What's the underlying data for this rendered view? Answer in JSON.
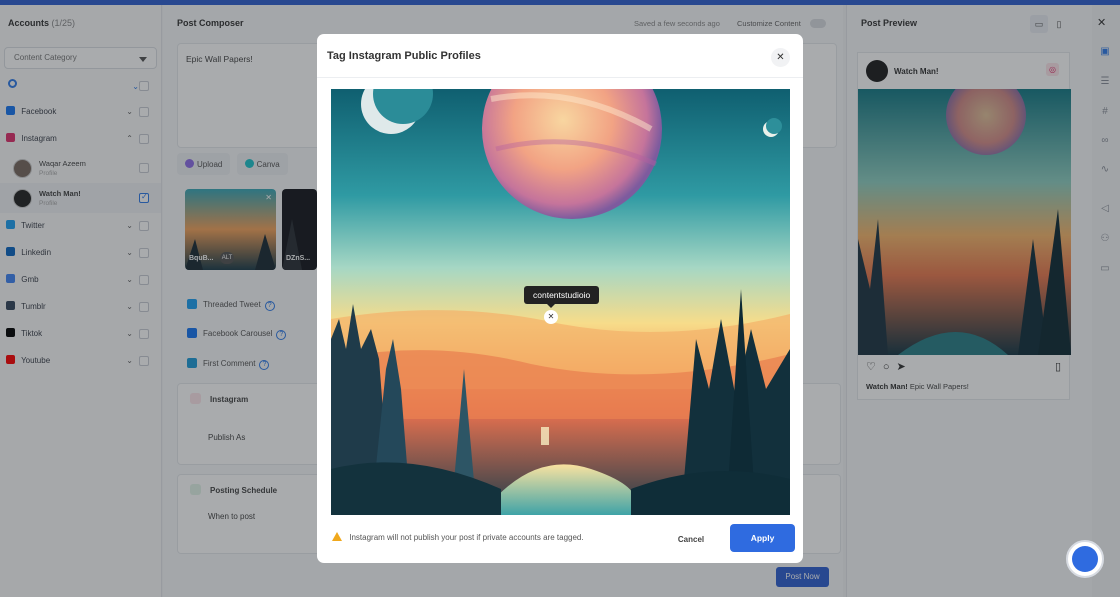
{
  "accounts": {
    "title": "Accounts",
    "count": "(1/25)",
    "category_placeholder": "Content Category",
    "networks": [
      {
        "name": "Facebook",
        "color": "#1877f2"
      },
      {
        "name": "Instagram",
        "color": "#e1306c"
      },
      {
        "name": "Twitter",
        "color": "#1da1f2"
      },
      {
        "name": "Linkedin",
        "color": "#0a66c2"
      },
      {
        "name": "Gmb",
        "color": "#4285f4"
      },
      {
        "name": "Tumblr",
        "color": "#35465c"
      },
      {
        "name": "Tiktok",
        "color": "#000000"
      },
      {
        "name": "Youtube",
        "color": "#ff0000"
      }
    ],
    "profiles": [
      {
        "name": "Waqar Azeem",
        "type": "Profile",
        "checked": false
      },
      {
        "name": "Watch Man!",
        "type": "Profile",
        "checked": true
      }
    ]
  },
  "composer": {
    "title": "Post Composer",
    "saved": "Saved a few seconds ago",
    "customize": "Customize Content",
    "text": "Epic Wall Papers!",
    "tools": [
      "Upload",
      "Canva"
    ],
    "thumbs": [
      "BquB...",
      "DZnS..."
    ],
    "thumb_alt": "ALT",
    "options": [
      "Threaded Tweet",
      "Facebook Carousel",
      "First Comment"
    ],
    "instagram_section": "Instagram",
    "publish_as": "Publish As",
    "schedule_section": "Posting Schedule",
    "when_to_post": "When to post",
    "post_now": "Post Now"
  },
  "preview": {
    "title": "Post Preview",
    "account_name": "Watch Man!",
    "caption_user": "Watch Man!",
    "caption_text": "Epic Wall Papers!"
  },
  "modal": {
    "title": "Tag Instagram Public Profiles",
    "tag_handle": "contentstudioio",
    "warning": "Instagram will not publish your post if private accounts are tagged.",
    "cancel": "Cancel",
    "apply": "Apply"
  },
  "colors": {
    "accent": "#2f6be0",
    "warning": "#f0a81c"
  }
}
